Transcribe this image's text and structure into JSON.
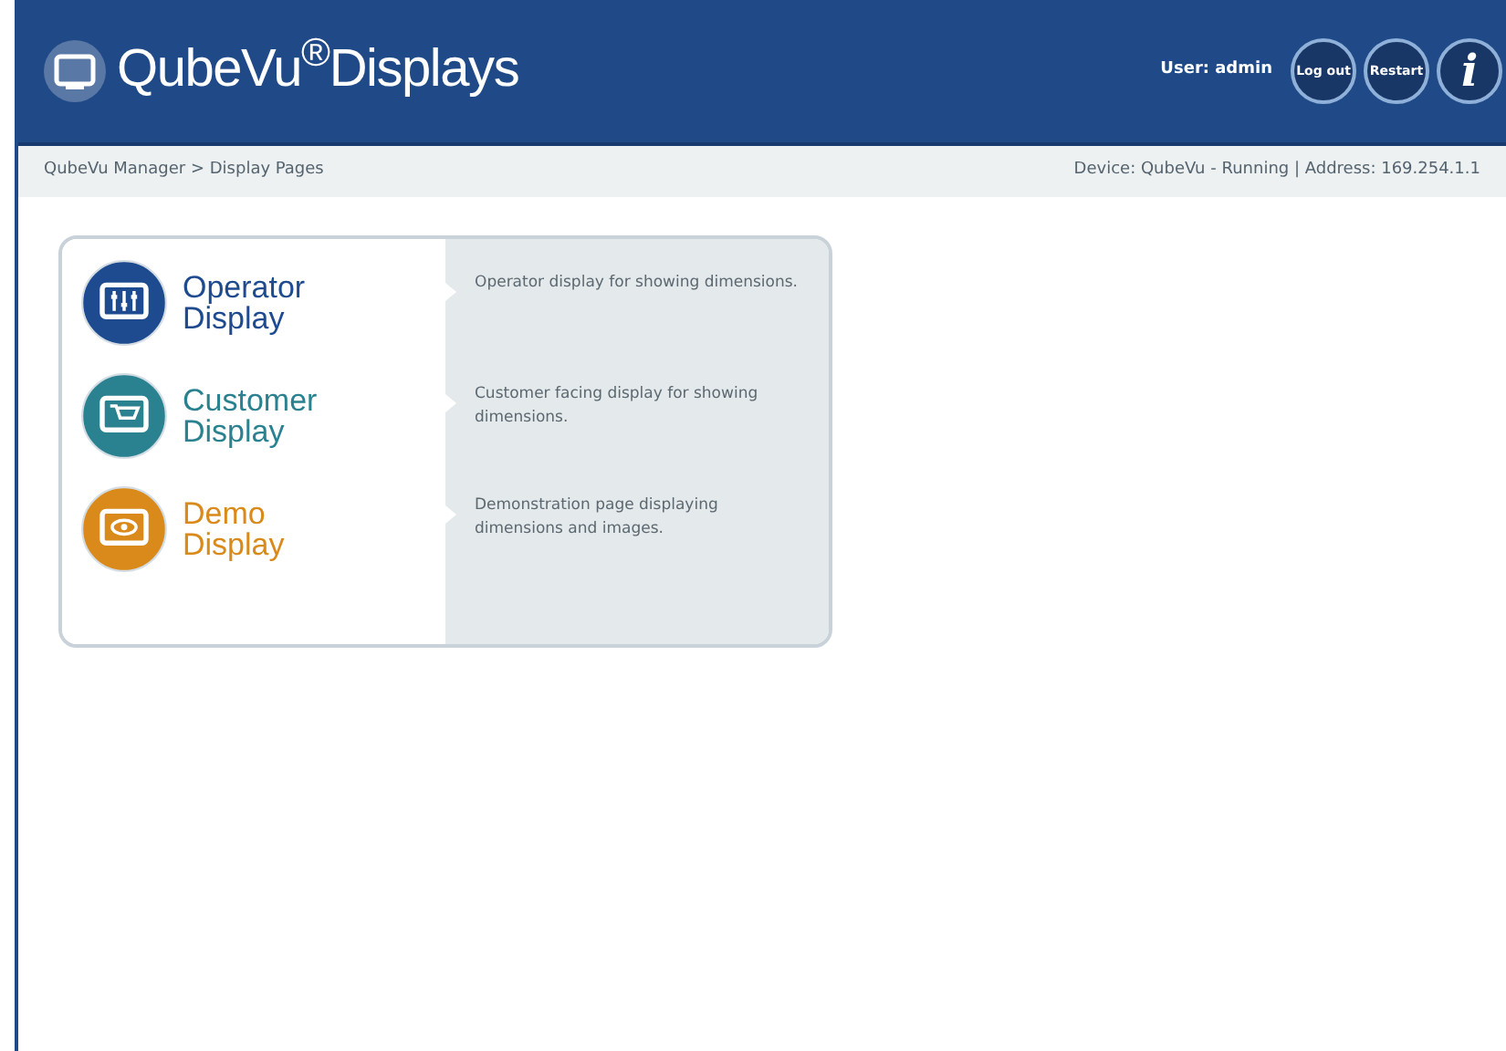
{
  "header": {
    "title": "QubeVu$^{®}$Displays",
    "user": "User: admin",
    "buttons": [
      {
        "kind": "text",
        "label": "Log out"
      },
      {
        "kind": "text",
        "label": "Restart"
      },
      {
        "kind": "info",
        "label": "i"
      }
    ]
  },
  "breadcrumb": {
    "path": "QubeVu Manager > Display Pages",
    "status": "Device: QubeVu - Running | Address: 169.254.1.1"
  },
  "displays": [
    {
      "kind": "sliders",
      "color": "#1e4b8f",
      "title_lines": [
        "Operator",
        "Display"
      ],
      "description": "Operator display for showing dimensions."
    },
    {
      "kind": "cart",
      "color": "#2a8190",
      "title_lines": [
        "Customer",
        "Display"
      ],
      "description": "Customer facing display for showing dimensions."
    },
    {
      "kind": "eye",
      "color": "#d98a1a",
      "title_lines": [
        "Demo",
        "Display"
      ],
      "description": "Demonstration page displaying dimensions and images."
    }
  ]
}
